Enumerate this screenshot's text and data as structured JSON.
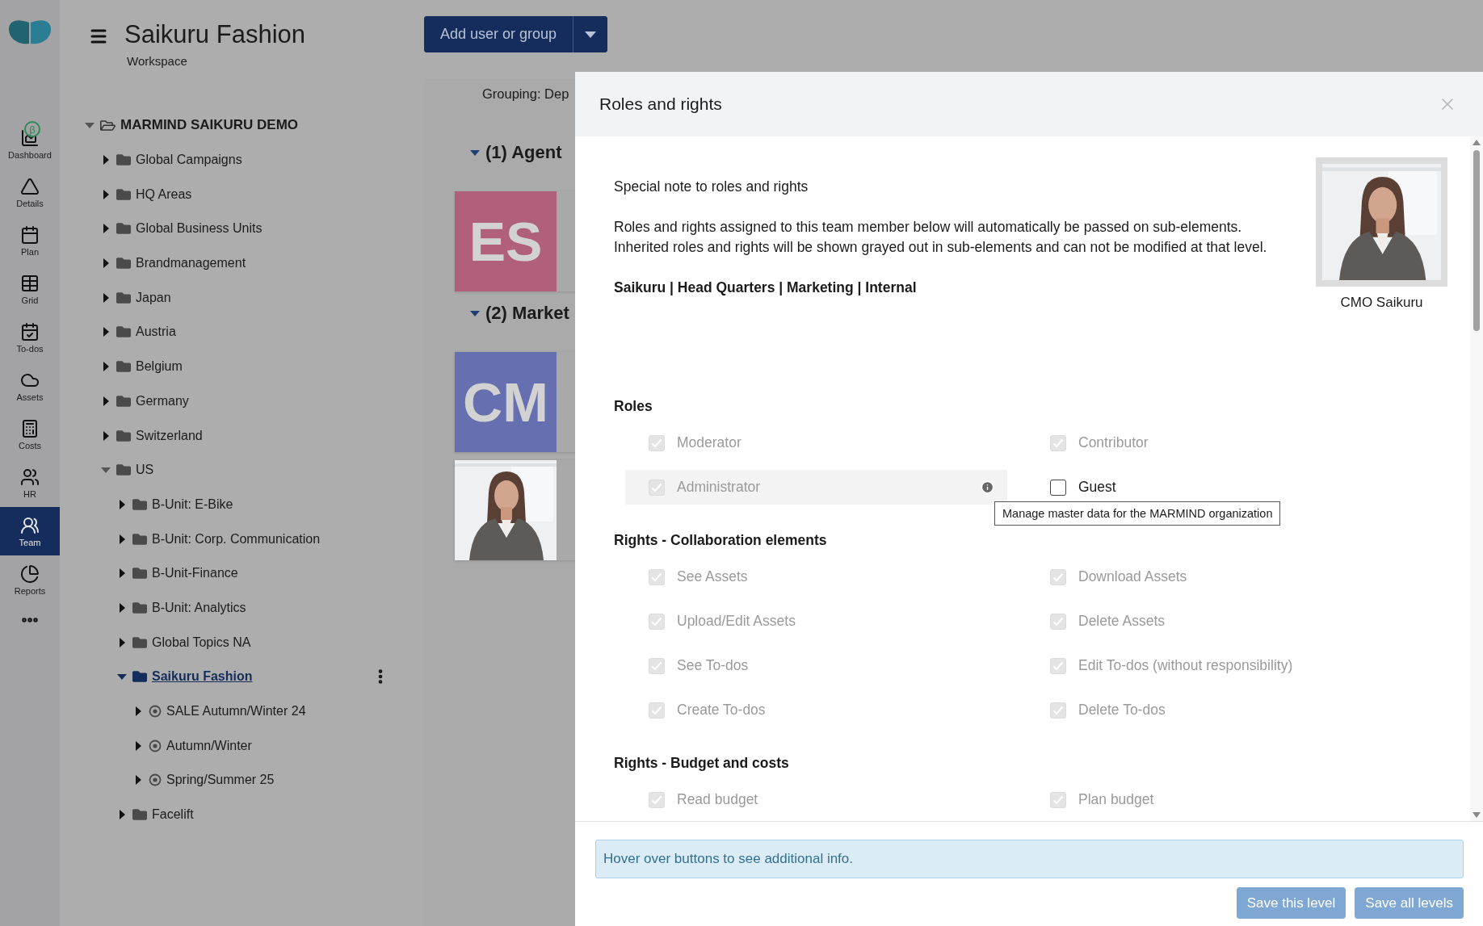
{
  "nav": {
    "items": [
      {
        "label": "Dashboard",
        "selected": false,
        "badge": "β"
      },
      {
        "label": "Details",
        "selected": false
      },
      {
        "label": "Plan",
        "selected": false
      },
      {
        "label": "Grid",
        "selected": false
      },
      {
        "label": "To-dos",
        "selected": false
      },
      {
        "label": "Assets",
        "selected": false
      },
      {
        "label": "Costs",
        "selected": false
      },
      {
        "label": "HR",
        "selected": false
      },
      {
        "label": "Team",
        "selected": true
      },
      {
        "label": "Reports",
        "selected": false
      }
    ]
  },
  "header": {
    "title": "Saikuru Fashion",
    "subtitle": "Workspace"
  },
  "tree": {
    "label": "MARMIND SAIKURU DEMO",
    "kind": "root",
    "expanded": true,
    "selected": false,
    "children": [
      {
        "label": "Global Campaigns",
        "kind": "folder",
        "expanded": false,
        "selected": false
      },
      {
        "label": "HQ Areas",
        "kind": "folder",
        "expanded": false,
        "selected": false
      },
      {
        "label": "Global Business Units",
        "kind": "folder",
        "expanded": false,
        "selected": false
      },
      {
        "label": "Brandmanagement",
        "kind": "folder",
        "expanded": false,
        "selected": false
      },
      {
        "label": "Japan",
        "kind": "folder",
        "expanded": false,
        "selected": false
      },
      {
        "label": "Austria",
        "kind": "folder",
        "expanded": false,
        "selected": false
      },
      {
        "label": "Belgium",
        "kind": "folder",
        "expanded": false,
        "selected": false
      },
      {
        "label": "Germany",
        "kind": "folder",
        "expanded": false,
        "selected": false
      },
      {
        "label": "Switzerland",
        "kind": "folder",
        "expanded": false,
        "selected": false
      },
      {
        "label": "US",
        "kind": "folder",
        "expanded": true,
        "selected": false,
        "children": [
          {
            "label": "B-Unit: E-Bike",
            "kind": "folder",
            "expanded": false,
            "selected": false
          },
          {
            "label": "B-Unit: Corp. Communication",
            "kind": "folder",
            "expanded": false,
            "selected": false
          },
          {
            "label": "B-Unit-Finance",
            "kind": "folder",
            "expanded": false,
            "selected": false
          },
          {
            "label": "B-Unit: Analytics",
            "kind": "folder",
            "expanded": false,
            "selected": false
          },
          {
            "label": "Global Topics NA",
            "kind": "folder",
            "expanded": false,
            "selected": false
          },
          {
            "label": "Saikuru Fashion",
            "kind": "folder",
            "expanded": true,
            "selected": true,
            "children": [
              {
                "label": "SALE Autumn/Winter 24",
                "kind": "campaign",
                "expanded": false,
                "selected": false
              },
              {
                "label": "Autumn/Winter",
                "kind": "campaign",
                "expanded": false,
                "selected": false
              },
              {
                "label": "Spring/Summer 25",
                "kind": "campaign",
                "expanded": false,
                "selected": false
              }
            ]
          },
          {
            "label": "Facelift",
            "kind": "folder",
            "expanded": false,
            "selected": false
          }
        ]
      }
    ]
  },
  "main": {
    "add_button": "Add user or group",
    "grouping": "Grouping:  Dep",
    "groups": [
      {
        "title": "(1) Agent",
        "expanded": true,
        "cards": [
          {
            "kind": "initials",
            "initials": "ES",
            "color": "#b0607a"
          }
        ]
      },
      {
        "title": "(2) Market",
        "expanded": true,
        "cards": [
          {
            "kind": "initials",
            "initials": "CM",
            "color": "#6670b0"
          },
          {
            "kind": "picture"
          }
        ]
      }
    ]
  },
  "modal": {
    "title": "Roles and rights",
    "note": "Special note to roles and rights",
    "description": [
      "Roles and rights assigned to this team member below will automatically be passed on sub-elements.",
      "Inherited roles and rights will be shown grayed out in sub-elements and can not be modified at that level."
    ],
    "path": "Saikuru | Head Quarters | Marketing | Internal",
    "person": {
      "caption": "CMO Saikuru"
    },
    "sections": [
      {
        "title": "Roles",
        "items": [
          {
            "label": "Moderator",
            "checked": true,
            "disabled": true,
            "hovered": false
          },
          {
            "label": "Contributor",
            "checked": true,
            "disabled": true,
            "hovered": false
          },
          {
            "label": "Administrator",
            "checked": true,
            "disabled": true,
            "hovered": true,
            "tooltip": "Manage master data for the MARMIND organization"
          },
          {
            "label": "Guest",
            "checked": false,
            "disabled": false,
            "hovered": false
          }
        ]
      },
      {
        "title": "Rights - Collaboration elements",
        "items": [
          {
            "label": "See Assets",
            "checked": true,
            "disabled": true,
            "hovered": false
          },
          {
            "label": "Download Assets",
            "checked": true,
            "disabled": true,
            "hovered": false
          },
          {
            "label": "Upload/Edit Assets",
            "checked": true,
            "disabled": true,
            "hovered": false
          },
          {
            "label": "Delete Assets",
            "checked": true,
            "disabled": true,
            "hovered": false
          },
          {
            "label": "See To-dos",
            "checked": true,
            "disabled": true,
            "hovered": false
          },
          {
            "label": "Edit To-dos (without responsibility)",
            "checked": true,
            "disabled": true,
            "hovered": false
          },
          {
            "label": "Create To-dos",
            "checked": true,
            "disabled": true,
            "hovered": false
          },
          {
            "label": "Delete To-dos",
            "checked": true,
            "disabled": true,
            "hovered": false
          }
        ]
      },
      {
        "title": "Rights - Budget and costs",
        "items": [
          {
            "label": "Read budget",
            "checked": true,
            "disabled": true,
            "hovered": false
          },
          {
            "label": "Plan budget",
            "checked": true,
            "disabled": true,
            "hovered": false
          }
        ]
      }
    ],
    "info": "Hover over buttons to see additional info.",
    "buttons": [
      "Save this level",
      "Save all levels"
    ]
  }
}
